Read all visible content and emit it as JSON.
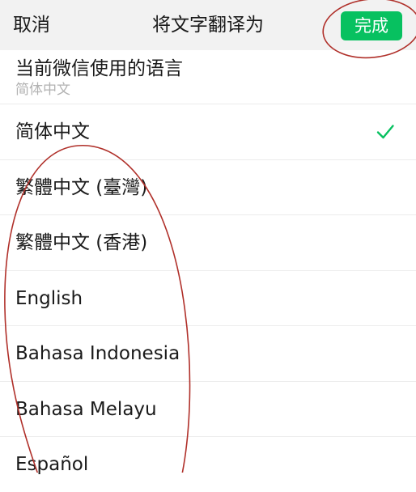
{
  "nav": {
    "cancel_label": "取消",
    "title": "将文字翻译为",
    "done_label": "完成"
  },
  "current_language": {
    "title": "当前微信使用的语言",
    "value": "简体中文"
  },
  "languages": [
    {
      "label": "简体中文",
      "selected": true
    },
    {
      "label": "繁體中文 (臺灣)",
      "selected": false
    },
    {
      "label": "繁體中文 (香港)",
      "selected": false
    },
    {
      "label": "English",
      "selected": false
    },
    {
      "label": "Bahasa Indonesia",
      "selected": false
    },
    {
      "label": "Bahasa Melayu",
      "selected": false
    },
    {
      "label": "Español",
      "selected": false
    }
  ],
  "icons": {
    "checkmark": "checkmark-icon"
  },
  "colors": {
    "accent": "#07c160",
    "annotation": "#b0302a",
    "nav_background": "#f2f2f2",
    "secondary_text": "#b2b2b2"
  }
}
